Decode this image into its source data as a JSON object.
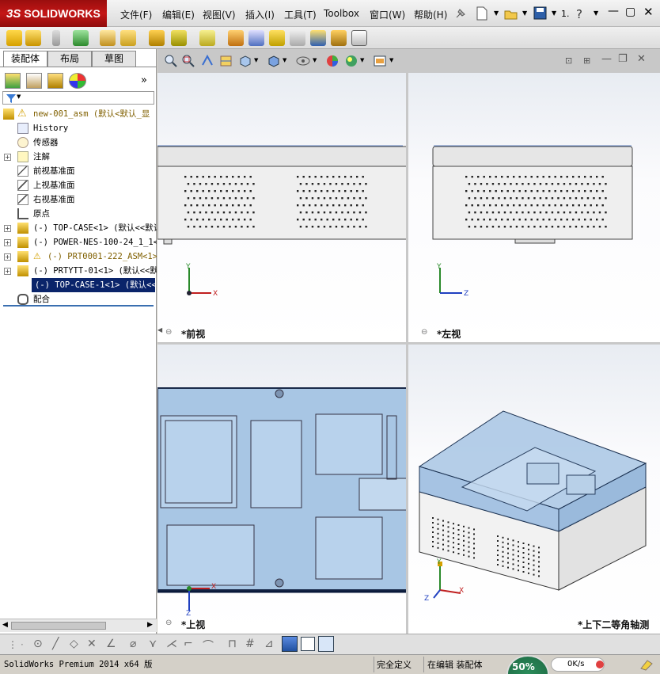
{
  "app": {
    "logo": "SOLIDWORKS",
    "logo_prefix": "3S",
    "brand_color": "#b01010"
  },
  "menu": [
    "文件(F)",
    "编辑(E)",
    "视图(V)",
    "插入(I)",
    "工具(T)",
    "Toolbox",
    "窗口(W)",
    "帮助(H)"
  ],
  "menu_extra": "1.",
  "tabs": [
    "装配体",
    "布局",
    "草图"
  ],
  "tree": {
    "root": "new-001_asm (默认<默认_显",
    "items": [
      {
        "label": "History",
        "mono": true
      },
      {
        "label": "传感器",
        "mono": false
      },
      {
        "label": "注解",
        "mono": false,
        "expandable": true
      },
      {
        "label": "前视基准面",
        "mono": false
      },
      {
        "label": "上视基准面",
        "mono": false
      },
      {
        "label": "右视基准面",
        "mono": false
      },
      {
        "label": "原点",
        "mono": false
      },
      {
        "label": "(-) TOP-CASE<1> (默认<<默认",
        "mono": true,
        "expandable": true
      },
      {
        "label": "(-) POWER-NES-100-24_1_1<",
        "mono": true,
        "expandable": true
      },
      {
        "label": "(-) PRT0001-222_ASM<1>",
        "mono": true,
        "expandable": true,
        "warning": true
      },
      {
        "label": "(-) PRTYTT-01<1> (默认<<默",
        "mono": true,
        "expandable": true
      },
      {
        "label": "(-) TOP-CASE-1<1> (默认<<默",
        "mono": true,
        "expandable": true,
        "selected": true
      },
      {
        "label": "配合",
        "mono": false
      }
    ]
  },
  "views": {
    "front": "*前视",
    "left": "*左视",
    "top": "*上视",
    "iso": "*上下二等角轴测"
  },
  "axes": {
    "x": "X",
    "y": "Y",
    "z": "Z"
  },
  "status": {
    "product": "SolidWorks Premium 2014 x64 版",
    "state1": "完全定义",
    "state2": "在编辑 装配体",
    "progress_text": "50%",
    "progress": 0.5,
    "speed": "0K/s"
  },
  "colors": {
    "part_blue": "#a8c6e4",
    "selected_row": "#0a246a"
  }
}
